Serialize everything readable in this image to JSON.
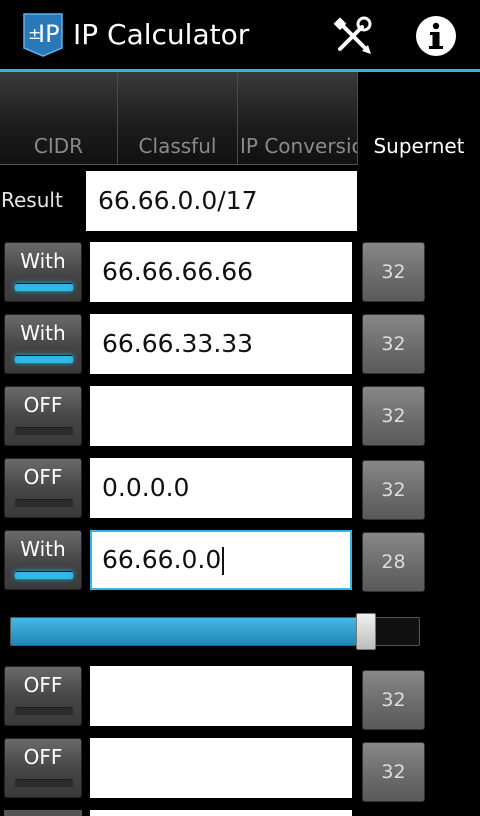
{
  "app": {
    "title": "IP Calculator",
    "logo_text": "±IP",
    "accent_color": "#33b5e5"
  },
  "actions": {
    "settings_icon": "wrench-screwdriver-icon",
    "info_icon": "info-icon"
  },
  "tabs": [
    {
      "label": "CIDR",
      "active": false
    },
    {
      "label": "Classful",
      "active": false
    },
    {
      "label": "IP  Conversio",
      "active": false
    },
    {
      "label": "Supernet",
      "active": true
    }
  ],
  "result": {
    "label": "Result",
    "value": "66.66.0.0/17"
  },
  "rows": [
    {
      "toggle": "With",
      "on": true,
      "ip": "66.66.66.66",
      "prefix": "32"
    },
    {
      "toggle": "With",
      "on": true,
      "ip": "66.66.33.33",
      "prefix": "32"
    },
    {
      "toggle": "OFF",
      "on": false,
      "ip": "",
      "prefix": "32"
    },
    {
      "toggle": "OFF",
      "on": false,
      "ip": "0.0.0.0",
      "prefix": "32"
    },
    {
      "toggle": "With",
      "on": true,
      "ip": "66.66.0.0",
      "prefix": "28",
      "focused": true
    },
    {
      "toggle": "OFF",
      "on": false,
      "ip": "",
      "prefix": "32"
    },
    {
      "toggle": "OFF",
      "on": false,
      "ip": "",
      "prefix": "32"
    }
  ],
  "slider": {
    "value_fraction": 0.85
  }
}
